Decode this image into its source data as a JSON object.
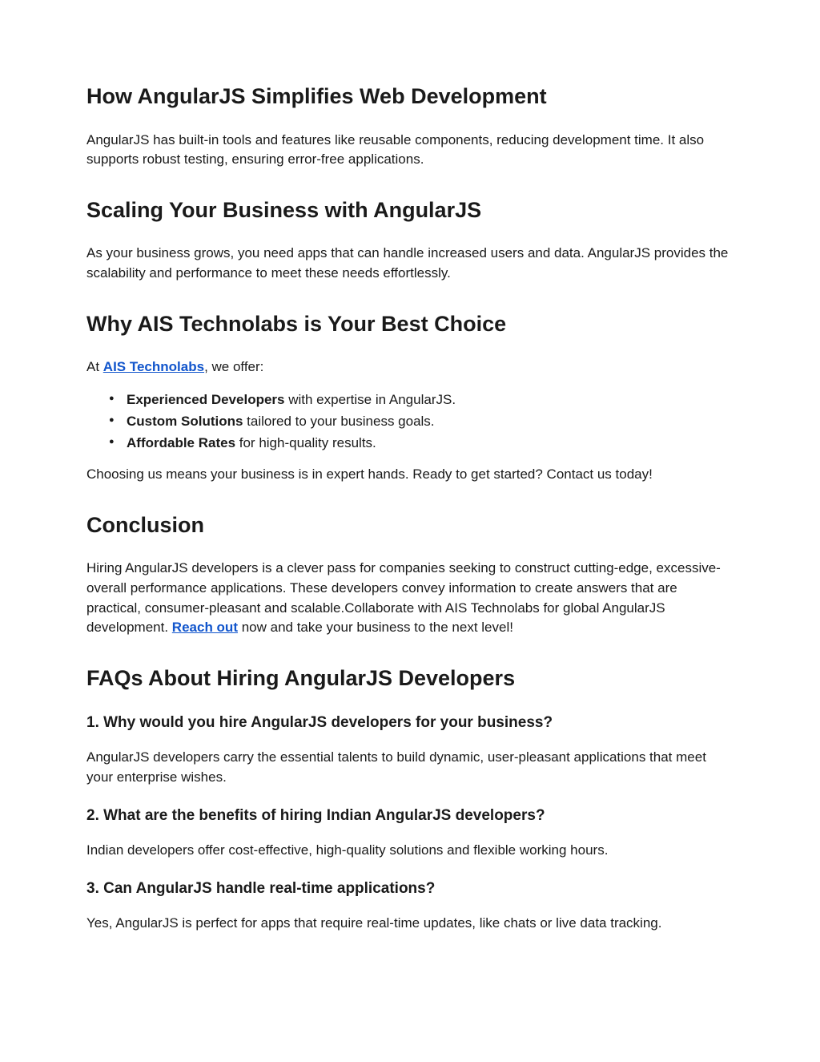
{
  "section1": {
    "heading": "How AngularJS Simplifies Web Development",
    "p1": "AngularJS has built-in tools and features like reusable components, reducing development time. It also supports robust testing, ensuring error-free applications."
  },
  "section2": {
    "heading": "Scaling Your Business with AngularJS",
    "p1": "As your business grows, you need apps that can handle increased users and data. AngularJS provides the scalability and performance to meet these needs effortlessly."
  },
  "section3": {
    "heading": "Why AIS Technolabs is Your Best Choice",
    "intro_prefix": "At ",
    "intro_link": "AIS Technolabs",
    "intro_suffix": ", we offer:",
    "bullets": [
      {
        "strong": "Experienced Developers",
        "rest": " with expertise in AngularJS."
      },
      {
        "strong": "Custom Solutions",
        "rest": " tailored to your business goals."
      },
      {
        "strong": "Affordable Rates",
        "rest": " for high-quality results."
      }
    ],
    "closing": "Choosing us means your business is in expert hands. Ready to get started? Contact us today!"
  },
  "section4": {
    "heading": "Conclusion",
    "p_prefix": "Hiring AngularJS developers is a clever pass for companies seeking to construct cutting-edge, excessive-overall performance applications. These developers convey information to create answers that are practical, consumer-pleasant and scalable.Collaborate with AIS Technolabs for global AngularJS development. ",
    "p_link": "Reach out",
    "p_suffix": " now and take your business to the next level!"
  },
  "section5": {
    "heading": "FAQs About Hiring AngularJS Developers",
    "faqs": [
      {
        "q": "1. Why would you hire AngularJS developers for your business?",
        "a": "AngularJS developers carry the essential talents to build dynamic, user-pleasant applications that meet your enterprise wishes."
      },
      {
        "q": "2. What are the benefits of hiring Indian AngularJS developers?",
        "a": "Indian developers offer cost-effective, high-quality solutions and flexible working hours."
      },
      {
        "q": "3. Can AngularJS handle real-time applications?",
        "a": "Yes, AngularJS is perfect for apps that require real-time updates, like chats or live data tracking."
      }
    ]
  }
}
